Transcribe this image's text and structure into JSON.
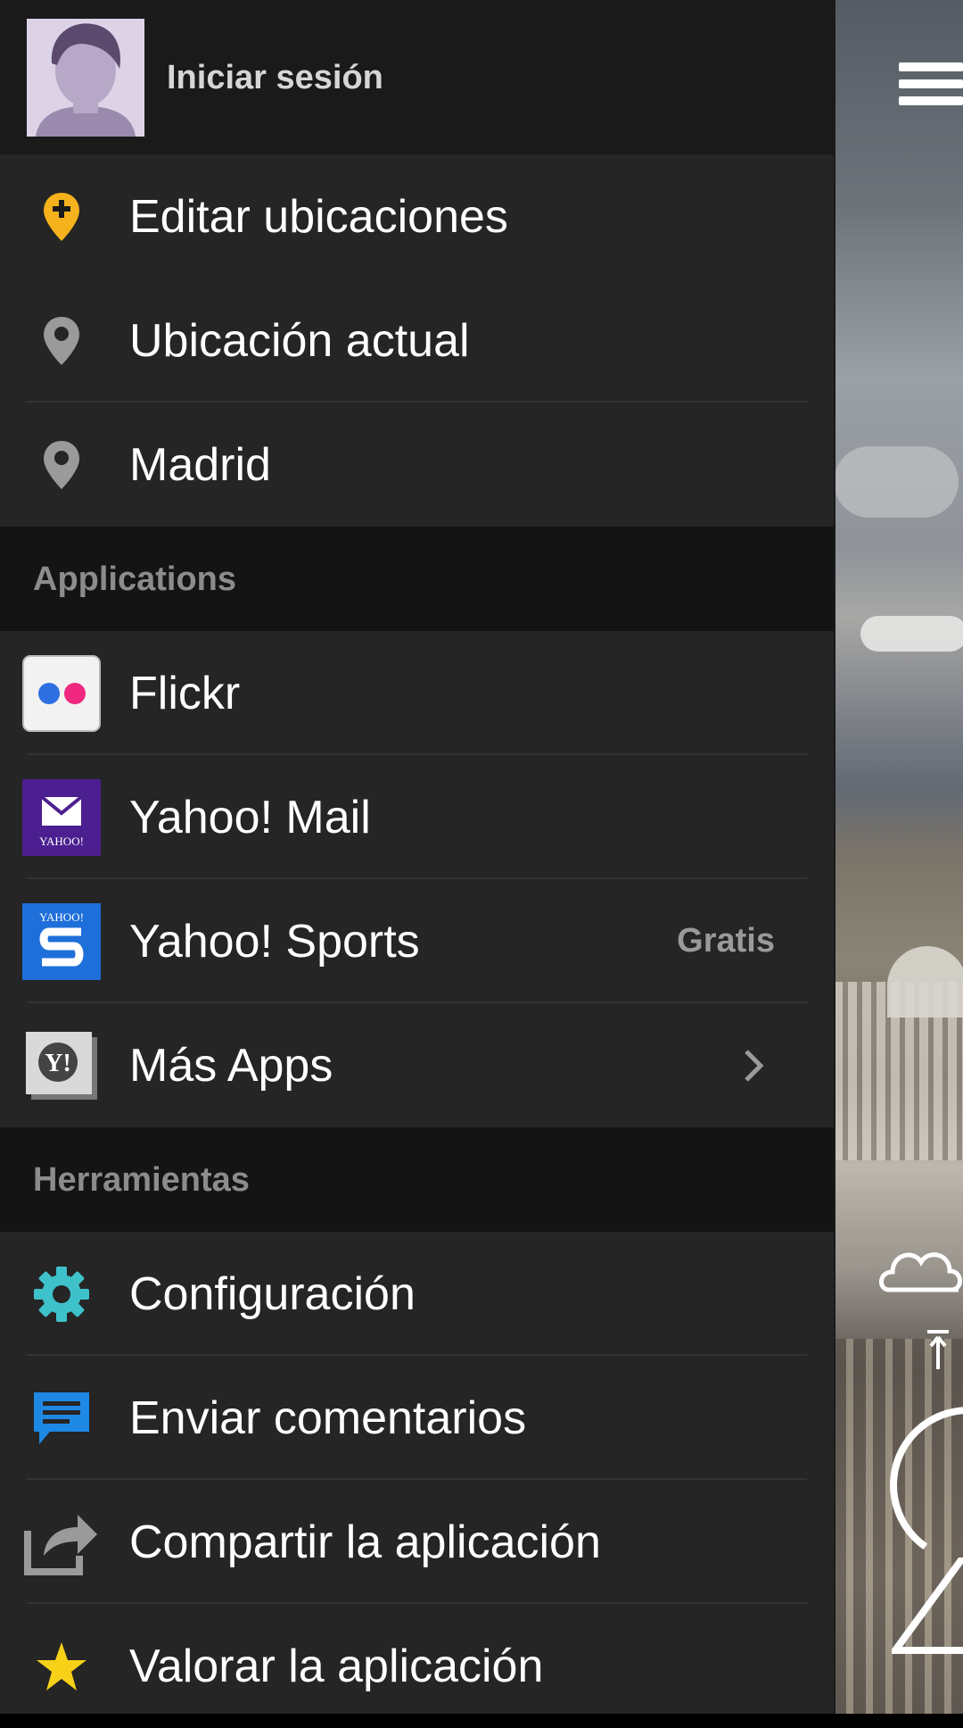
{
  "header": {
    "signin_label": "Iniciar sesión"
  },
  "locations": [
    {
      "label": "Editar ubicaciones",
      "icon": "add-location-icon",
      "color": "#f5b21c"
    },
    {
      "label": "Ubicación actual",
      "icon": "location-pin-icon",
      "color": "#9a9a9a"
    },
    {
      "label": "Madrid",
      "icon": "location-pin-icon",
      "color": "#9a9a9a"
    }
  ],
  "applications": {
    "header": "Applications",
    "items": [
      {
        "label": "Flickr",
        "icon": "flickr-icon"
      },
      {
        "label": "Yahoo! Mail",
        "icon": "yahoo-mail-icon"
      },
      {
        "label": "Yahoo! Sports",
        "icon": "yahoo-sports-icon",
        "badge": "Gratis"
      },
      {
        "label": "Más Apps",
        "icon": "more-apps-icon"
      }
    ]
  },
  "tools": {
    "header": "Herramientas",
    "items": [
      {
        "label": "Configuración",
        "icon": "gear-icon",
        "color": "#3fc1c9"
      },
      {
        "label": "Enviar comentarios",
        "icon": "feedback-icon",
        "color": "#1e88e5"
      },
      {
        "label": "Compartir la aplicación",
        "icon": "share-icon",
        "color": "#9a9a9a"
      },
      {
        "label": "Valorar la aplicación",
        "icon": "star-icon",
        "color": "#f7d117"
      }
    ]
  }
}
